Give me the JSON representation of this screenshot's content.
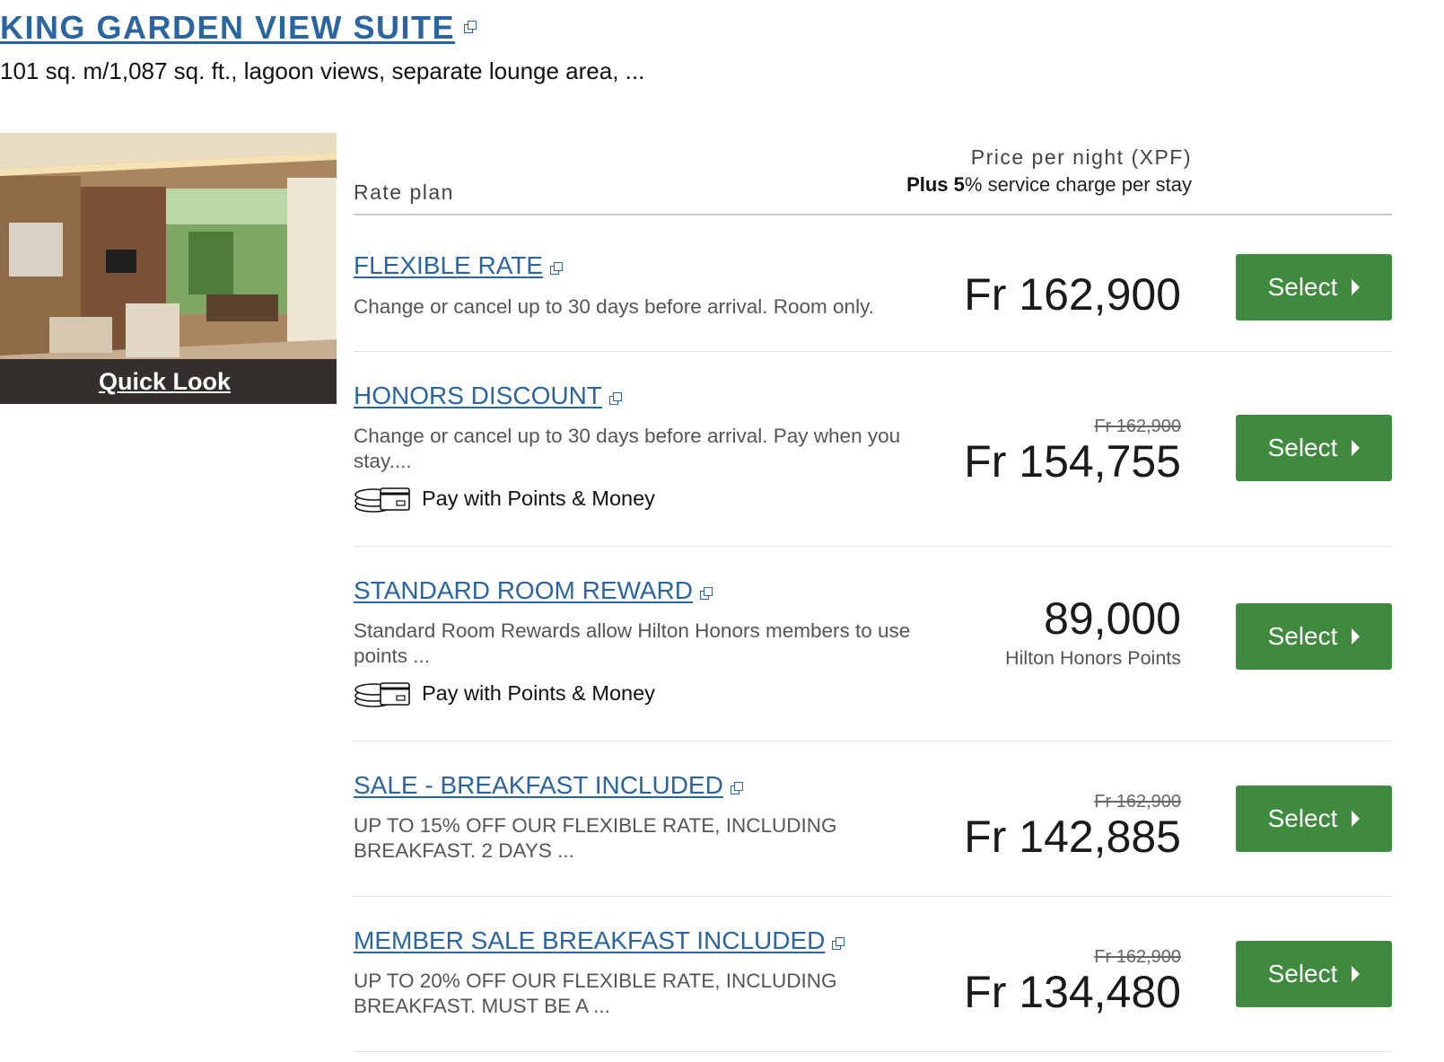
{
  "room": {
    "title": "KING GARDEN VIEW SUITE",
    "description": "101 sq. m/1,087 sq. ft., lagoon views, separate lounge area, ...",
    "quick_look": "Quick Look"
  },
  "table_header": {
    "rate_plan": "Rate plan",
    "price_per_night": "Price per night (XPF)",
    "service_charge_prefix": "Plus 5",
    "service_charge_suffix": "% service charge per stay"
  },
  "rates": [
    {
      "name": "FLEXIBLE RATE",
      "description": "Change or cancel up to 30 days before arrival. Room only.",
      "pay_with_points": "",
      "old_price": "",
      "price": "Fr 162,900",
      "price_note": "",
      "button": "Select"
    },
    {
      "name": "HONORS DISCOUNT",
      "description": "Change or cancel up to 30 days before arrival. Pay when you stay....",
      "pay_with_points": "Pay with Points & Money",
      "old_price": "Fr 162,900",
      "price": "Fr 154,755",
      "price_note": "",
      "button": "Select"
    },
    {
      "name": "STANDARD ROOM REWARD",
      "description": "Standard Room Rewards allow Hilton Honors members to use points ...",
      "pay_with_points": "Pay with Points & Money",
      "old_price": "",
      "price": "89,000",
      "price_note": "Hilton Honors Points",
      "button": "Select"
    },
    {
      "name": "SALE - BREAKFAST INCLUDED",
      "description": "UP TO 15% OFF OUR FLEXIBLE RATE, INCLUDING BREAKFAST. 2 DAYS ...",
      "pay_with_points": "",
      "old_price": "Fr 162,900",
      "price": "Fr 142,885",
      "price_note": "",
      "button": "Select"
    },
    {
      "name": "MEMBER SALE BREAKFAST INCLUDED",
      "description": "UP TO 20% OFF OUR FLEXIBLE RATE, INCLUDING BREAKFAST. MUST BE A ...",
      "pay_with_points": "",
      "old_price": "Fr 162,900",
      "price": "Fr 134,480",
      "price_note": "",
      "button": "Select"
    }
  ],
  "colors": {
    "link_blue": "#2a65a0",
    "button_green": "#3f8a3f"
  },
  "icons": {
    "external_link": "external-link-icon",
    "points_money": "coins-card-icon",
    "caret": "caret-right-icon"
  }
}
